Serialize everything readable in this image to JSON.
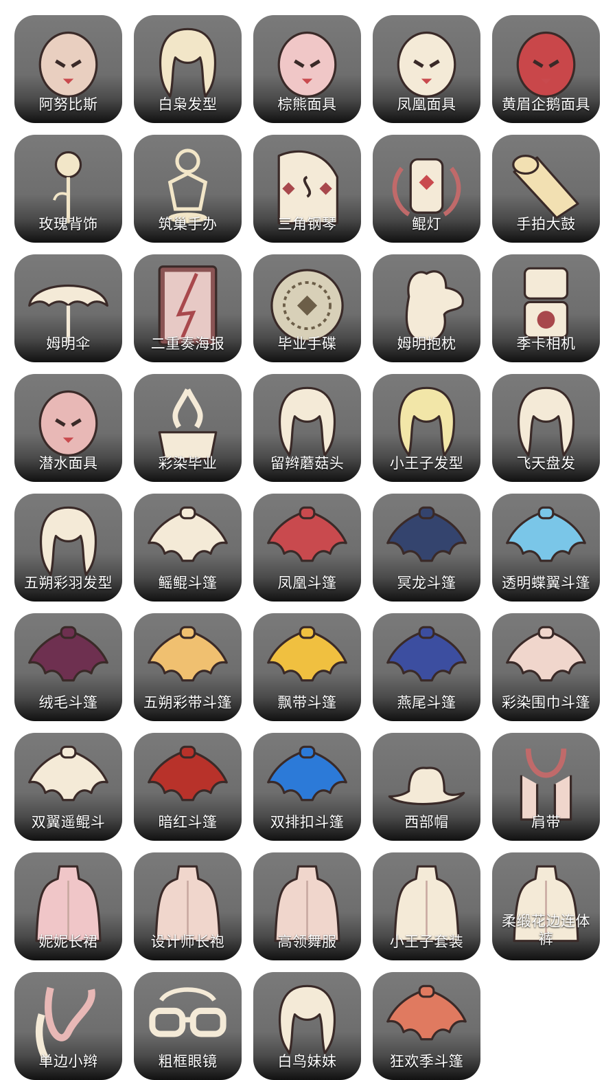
{
  "items": [
    {
      "label": "阿努比斯",
      "icon": "anubis-mask-icon",
      "color": "#e9cfc0"
    },
    {
      "label": "白枭发型",
      "icon": "owl-hair-icon",
      "color": "#f2e6c8"
    },
    {
      "label": "棕熊面具",
      "icon": "bear-mask-icon",
      "color": "#f0c7c7"
    },
    {
      "label": "凤凰面具",
      "icon": "phoenix-mask-icon",
      "color": "#f4ead7"
    },
    {
      "label": "黄眉企鹅面具",
      "icon": "penguin-mask-icon",
      "color": "#c9474a"
    },
    {
      "label": "玫瑰背饰",
      "icon": "rose-icon",
      "color": "#f2e6c8"
    },
    {
      "label": "筑巢手办",
      "icon": "figurine-icon",
      "color": "#f2e6c8"
    },
    {
      "label": "三角钢琴",
      "icon": "piano-icon",
      "color": "#f4ead7"
    },
    {
      "label": "鲲灯",
      "icon": "lantern-icon",
      "color": "#f4ead7"
    },
    {
      "label": "手拍大鼓",
      "icon": "drum-icon",
      "color": "#f2e0b2"
    },
    {
      "label": "姆明伞",
      "icon": "umbrella-icon",
      "color": "#f4ead7"
    },
    {
      "label": "二重奏海报",
      "icon": "poster-icon",
      "color": "#e7c9c5"
    },
    {
      "label": "毕业手碟",
      "icon": "handpan-icon",
      "color": "#d8d0b8"
    },
    {
      "label": "姆明抱枕",
      "icon": "moomin-icon",
      "color": "#f4ead7"
    },
    {
      "label": "季卡相机",
      "icon": "camera-icon",
      "color": "#f4ead7"
    },
    {
      "label": "潜水面具",
      "icon": "diving-mask-icon",
      "color": "#e8b8b6"
    },
    {
      "label": "彩染毕业",
      "icon": "graduation-icon",
      "color": "#f4ead7"
    },
    {
      "label": "留辫蘑菇头",
      "icon": "mushroom-hair-icon",
      "color": "#f4ead7"
    },
    {
      "label": "小王子发型",
      "icon": "prince-hair-icon",
      "color": "#f2e6a8"
    },
    {
      "label": "飞天盘发",
      "icon": "bun-hair-icon",
      "color": "#f4ead7"
    },
    {
      "label": "五朔彩羽发型",
      "icon": "feather-hair-icon",
      "color": "#f4ead7"
    },
    {
      "label": "鳐鲲斗篷",
      "icon": "ray-cape-icon",
      "color": "#f4ead7"
    },
    {
      "label": "凤凰斗篷",
      "icon": "phoenix-cape-icon",
      "color": "#c94a4e"
    },
    {
      "label": "冥龙斗篷",
      "icon": "krill-cape-icon",
      "color": "#34446e"
    },
    {
      "label": "透明蝶翼斗篷",
      "icon": "butterfly-cape-icon",
      "color": "#7ac6e8"
    },
    {
      "label": "绒毛斗篷",
      "icon": "fluffy-cape-icon",
      "color": "#6e3050"
    },
    {
      "label": "五朔彩带斗篷",
      "icon": "ribbon-cape-icon",
      "color": "#f0c070"
    },
    {
      "label": "飘带斗篷",
      "icon": "streamer-cape-icon",
      "color": "#f0c040"
    },
    {
      "label": "燕尾斗篷",
      "icon": "swallowtail-cape-icon",
      "color": "#3c4ea0"
    },
    {
      "label": "彩染围巾斗篷",
      "icon": "scarf-cape-icon",
      "color": "#f0d6cc"
    },
    {
      "label": "双翼遥鲲斗",
      "icon": "wings-cape-icon",
      "color": "#f4ead7"
    },
    {
      "label": "暗红斗篷",
      "icon": "red-cape-icon",
      "color": "#b8322a"
    },
    {
      "label": "双排扣斗篷",
      "icon": "blue-cape-icon",
      "color": "#2c7ad8"
    },
    {
      "label": "西部帽",
      "icon": "cowboy-hat-icon",
      "color": "#f4ead7"
    },
    {
      "label": "肩带",
      "icon": "shoulder-strap-icon",
      "color": "#f0d6cc"
    },
    {
      "label": "妮妮长裙",
      "icon": "dress-icon",
      "color": "#f0c6c8"
    },
    {
      "label": "设计师长袍",
      "icon": "robe-icon",
      "color": "#f0d6cc"
    },
    {
      "label": "高领舞服",
      "icon": "dance-outfit-icon",
      "color": "#f0d6cc"
    },
    {
      "label": "小王子套装",
      "icon": "prince-outfit-icon",
      "color": "#f4ead7"
    },
    {
      "label": "柔缎花边连体裤",
      "icon": "jumpsuit-icon",
      "color": "#f4ead7"
    },
    {
      "label": "单边小辫",
      "icon": "side-braid-icon",
      "color": "#e8b8b6"
    },
    {
      "label": "粗框眼镜",
      "icon": "glasses-icon",
      "color": "#f4ead7"
    },
    {
      "label": "白鸟妹妹",
      "icon": "bird-hair-icon",
      "color": "#f4ead7"
    },
    {
      "label": "狂欢季斗篷",
      "icon": "carnival-cape-icon",
      "color": "#e07a60"
    }
  ]
}
